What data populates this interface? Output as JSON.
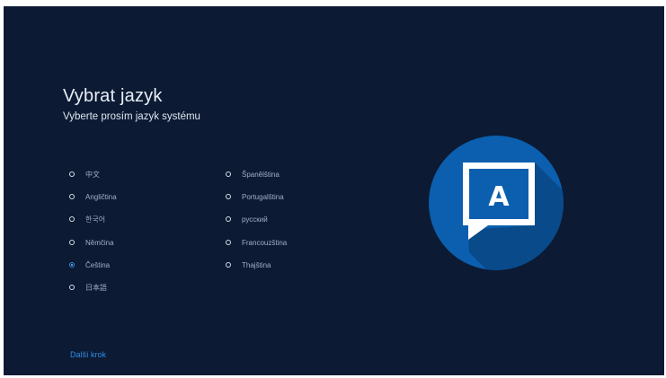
{
  "header": {
    "title": "Vybrat jazyk",
    "subtitle": "Vyberte prosím jazyk systému"
  },
  "languages": [
    {
      "label": "中文",
      "selected": false
    },
    {
      "label": "Angličtina",
      "selected": false
    },
    {
      "label": "한국어",
      "selected": false
    },
    {
      "label": "Němčina",
      "selected": false
    },
    {
      "label": "Čeština",
      "selected": true
    },
    {
      "label": "日本語",
      "selected": false
    },
    {
      "label": "Španělština",
      "selected": false
    },
    {
      "label": "Portugalština",
      "selected": false
    },
    {
      "label": "русский",
      "selected": false
    },
    {
      "label": "Francouzština",
      "selected": false
    },
    {
      "label": "Thajština",
      "selected": false
    }
  ],
  "footer": {
    "next_label": "Další krok"
  },
  "emblem": {
    "letter": "A",
    "icon": "language-speech-bubble-icon"
  },
  "colors": {
    "background": "#0c1a33",
    "accent": "#2f8de4",
    "emblem_circle": "#0b5fae",
    "emblem_shadow": "#084a8a"
  }
}
